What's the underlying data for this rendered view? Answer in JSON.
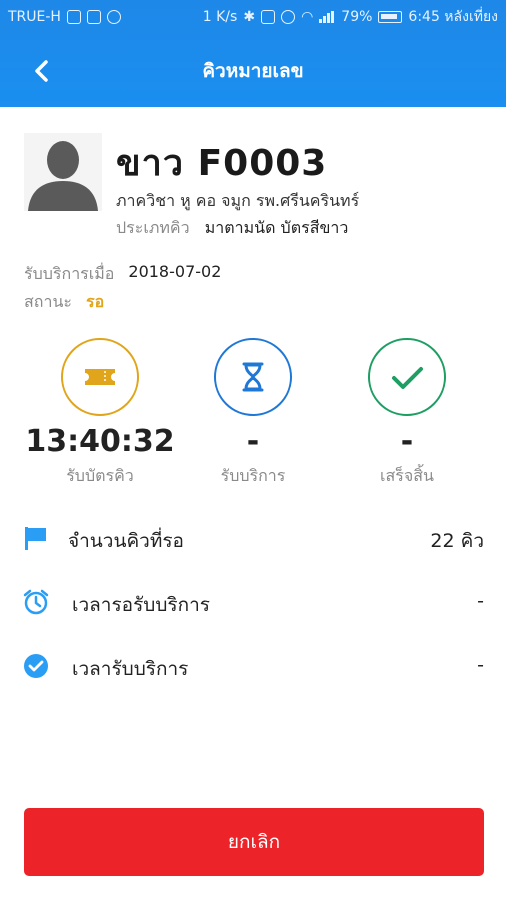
{
  "status_bar": {
    "carrier": "TRUE-H",
    "speed": "1 K/s",
    "battery": "79%",
    "time": "6:45 หลังเที่ยง"
  },
  "header": {
    "title": "คิวหมายเลข"
  },
  "ticket": {
    "number": "ขาว F0003",
    "department": "ภาควิชา หู คอ จมูก รพ.ศรีนครินทร์",
    "queue_type_label": "ประเภทคิว",
    "queue_type_value": "มาตามนัด บัตรสีขาว"
  },
  "info": {
    "service_date_label": "รับบริการเมื่อ",
    "service_date_value": "2018-07-02",
    "status_label": "สถานะ",
    "status_value": "รอ"
  },
  "steps": [
    {
      "time": "13:40:32",
      "label": "รับบัตรคิว",
      "icon": "ticket-icon",
      "color": "#e0a51a"
    },
    {
      "time": "-",
      "label": "รับบริการ",
      "icon": "hourglass-icon",
      "color": "#1f78d6"
    },
    {
      "time": "-",
      "label": "เสร็จสิ้น",
      "icon": "check-icon",
      "color": "#1e9e63"
    }
  ],
  "details": [
    {
      "label": "จำนวนคิวที่รอ",
      "value": "22  คิว",
      "icon": "flag-icon"
    },
    {
      "label": "เวลารอรับบริการ",
      "value": "-",
      "icon": "alarm-clock-icon"
    },
    {
      "label": "เวลารับบริการ",
      "value": "-",
      "icon": "check-circle-icon"
    }
  ],
  "actions": {
    "cancel_label": "ยกเลิก"
  },
  "colors": {
    "header": "#1a8ff0",
    "cancel": "#ec2329",
    "status_pending": "#e0a51a",
    "detail_icon": "#2a9df4"
  }
}
